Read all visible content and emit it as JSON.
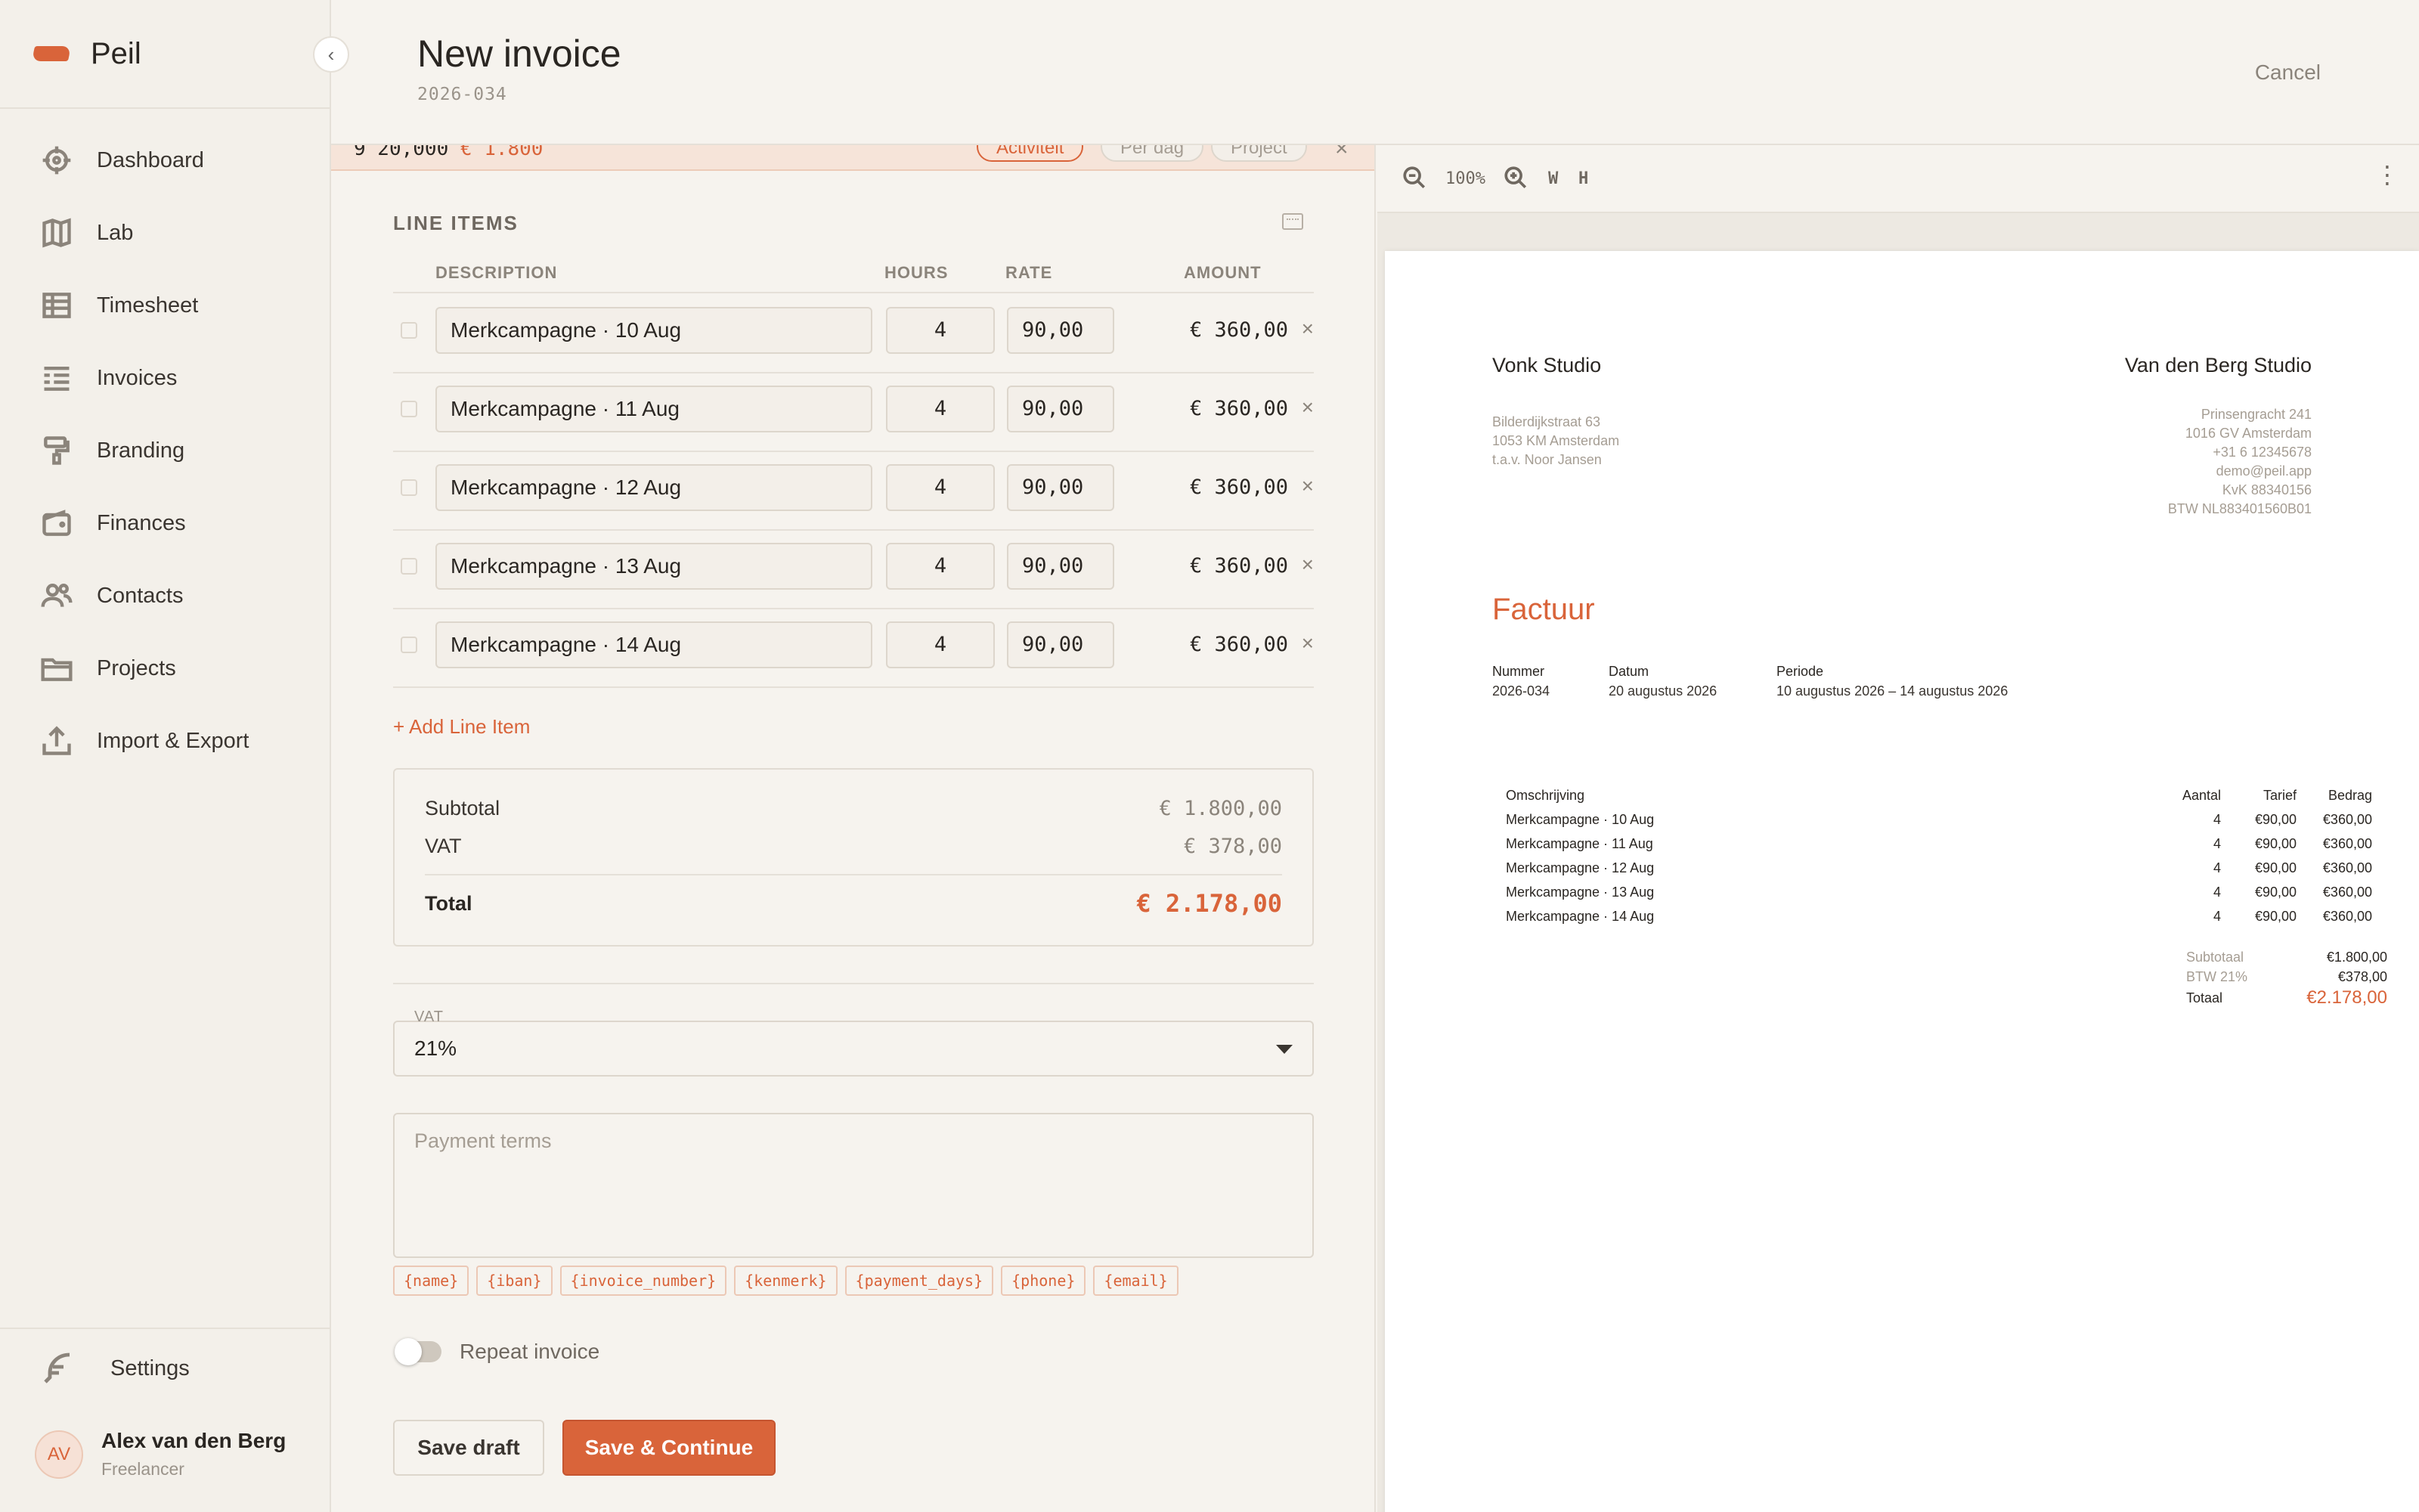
{
  "sidebar": {
    "brand": "Peil",
    "items": [
      {
        "label": "Dashboard",
        "icon": "crosshair-icon"
      },
      {
        "label": "Lab",
        "icon": "map-icon"
      },
      {
        "label": "Timesheet",
        "icon": "table-icon"
      },
      {
        "label": "Invoices",
        "icon": "invoice-list-icon"
      },
      {
        "label": "Branding",
        "icon": "paint-roller-icon"
      },
      {
        "label": "Finances",
        "icon": "wallet-icon"
      },
      {
        "label": "Contacts",
        "icon": "users-icon"
      },
      {
        "label": "Projects",
        "icon": "folder-icon"
      },
      {
        "label": "Import & Export",
        "icon": "upload-icon"
      }
    ],
    "settings": "Settings",
    "user": {
      "initials": "AV",
      "name": "Alex van den Berg",
      "role": "Freelancer"
    }
  },
  "header": {
    "title": "New invoice",
    "number": "2026-034",
    "cancel": "Cancel"
  },
  "strip": {
    "prefix": "9 20,000",
    "amount": "€ 1.800",
    "modes": [
      {
        "label": "Activiteit",
        "active": true
      },
      {
        "label": "Per dag",
        "active": false
      },
      {
        "label": "Project",
        "active": false
      }
    ],
    "close": "×"
  },
  "line_items": {
    "title": "LINE ITEMS",
    "columns": {
      "description": "DESCRIPTION",
      "hours": "HOURS",
      "rate": "RATE",
      "amount": "AMOUNT"
    },
    "rows": [
      {
        "description": "Merkcampagne · 10 Aug",
        "hours": "4",
        "rate": "90,00",
        "amount": "€ 360,00"
      },
      {
        "description": "Merkcampagne · 11 Aug",
        "hours": "4",
        "rate": "90,00",
        "amount": "€ 360,00"
      },
      {
        "description": "Merkcampagne · 12 Aug",
        "hours": "4",
        "rate": "90,00",
        "amount": "€ 360,00"
      },
      {
        "description": "Merkcampagne · 13 Aug",
        "hours": "4",
        "rate": "90,00",
        "amount": "€ 360,00"
      },
      {
        "description": "Merkcampagne · 14 Aug",
        "hours": "4",
        "rate": "90,00",
        "amount": "€ 360,00"
      }
    ],
    "add_label": "+ Add Line Item"
  },
  "totals": {
    "subtotal_label": "Subtotal",
    "subtotal": "€ 1.800,00",
    "vat_label": "VAT",
    "vat": "€ 378,00",
    "total_label": "Total",
    "total": "€ 2.178,00"
  },
  "vat_field": {
    "label": "VAT",
    "value": "21%"
  },
  "payment_terms": {
    "placeholder": "Payment terms"
  },
  "placeholders": [
    "{name}",
    "{iban}",
    "{invoice_number}",
    "{kenmerk}",
    "{payment_days}",
    "{phone}",
    "{email}"
  ],
  "repeat": {
    "label": "Repeat invoice",
    "enabled": false
  },
  "actions": {
    "draft": "Save draft",
    "save": "Save & Continue"
  },
  "preview_toolbar": {
    "zoom": "100%",
    "fit_width": "W",
    "fit_height": "H"
  },
  "preview": {
    "from": "Vonk Studio",
    "to": "Van den Berg Studio",
    "client_address": [
      "Bilderdijkstraat 63",
      "1053 KM Amsterdam",
      "t.a.v. Noor Jansen"
    ],
    "sender_details": [
      "Prinsengracht 241",
      "1016 GV  Amsterdam",
      "+31 6 12345678",
      "demo@peil.app",
      "KvK 88340156",
      "BTW NL883401560B01"
    ],
    "title": "Factuur",
    "meta": [
      {
        "label": "Nummer",
        "value": "2026-034"
      },
      {
        "label": "Datum",
        "value": "20 augustus 2026"
      },
      {
        "label": "Periode",
        "value": "10 augustus 2026 – 14 augustus 2026"
      }
    ],
    "table_head": {
      "desc": "Omschrijving",
      "qty": "Aantal",
      "rate": "Tarief",
      "amount": "Bedrag"
    },
    "rows": [
      {
        "desc": "Merkcampagne · 10 Aug",
        "qty": "4",
        "rate": "€90,00",
        "amount": "€360,00"
      },
      {
        "desc": "Merkcampagne · 11 Aug",
        "qty": "4",
        "rate": "€90,00",
        "amount": "€360,00"
      },
      {
        "desc": "Merkcampagne · 12 Aug",
        "qty": "4",
        "rate": "€90,00",
        "amount": "€360,00"
      },
      {
        "desc": "Merkcampagne · 13 Aug",
        "qty": "4",
        "rate": "€90,00",
        "amount": "€360,00"
      },
      {
        "desc": "Merkcampagne · 14 Aug",
        "qty": "4",
        "rate": "€90,00",
        "amount": "€360,00"
      }
    ],
    "subtotal_label": "Subtotaal",
    "subtotal": "€1.800,00",
    "vat_label": "BTW 21%",
    "vat": "€378,00",
    "total_label": "Totaal",
    "total": "€2.178,00"
  },
  "colors": {
    "accent": "#d9643a",
    "background": "#f6f3ee",
    "border": "#e5e0d8",
    "muted": "#8b847b"
  }
}
